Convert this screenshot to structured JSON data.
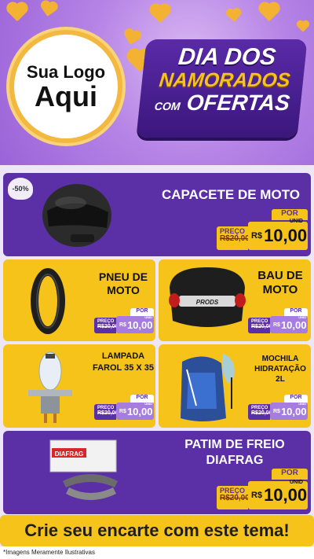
{
  "header": {
    "logo_line1": "Sua Logo",
    "logo_line2": "Aqui",
    "badge_line1": "DIA DOS",
    "badge_line2": "NAMORADOS",
    "badge_line3a": "COM",
    "badge_line3b": "OFERTAS"
  },
  "products": [
    {
      "name": "CAPACETE DE MOTO",
      "discount": "-50%",
      "old_label": "PREÇO",
      "old_price": "R$20,00",
      "por": "POR",
      "currency": "R$",
      "price": "10,00",
      "unid": "UNID"
    },
    {
      "name": "PNEU DE MOTO",
      "old_label": "PREÇO",
      "old_price": "R$20,00",
      "por": "POR",
      "currency": "R$",
      "price": "10,00",
      "unid": "UNID"
    },
    {
      "name": "BAU DE MOTO",
      "old_label": "PREÇO",
      "old_price": "R$20,00",
      "por": "POR",
      "currency": "R$",
      "price": "10,00",
      "unid": "UNID",
      "brand": "PRODS"
    },
    {
      "name": "LAMPADA FAROL 35 X 35",
      "old_label": "PREÇO",
      "old_price": "R$20,00",
      "por": "POR",
      "currency": "R$",
      "price": "10,00",
      "unid": "UNID"
    },
    {
      "name": "MOCHILA HIDRATAÇÃO 2L",
      "old_label": "PREÇO",
      "old_price": "R$20,00",
      "por": "POR",
      "currency": "R$",
      "price": "10,00",
      "unid": "UNID"
    },
    {
      "name": "PATIM DE FREIO DIAFRAG",
      "old_label": "PREÇO",
      "old_price": "R$20,00",
      "por": "POR",
      "currency": "R$",
      "price": "10,00",
      "unid": "UNID",
      "brand": "DIAFRAG"
    }
  ],
  "cta": "Crie seu encarte com este tema!",
  "footer": "*Imagens Meramente Ilustrativas"
}
